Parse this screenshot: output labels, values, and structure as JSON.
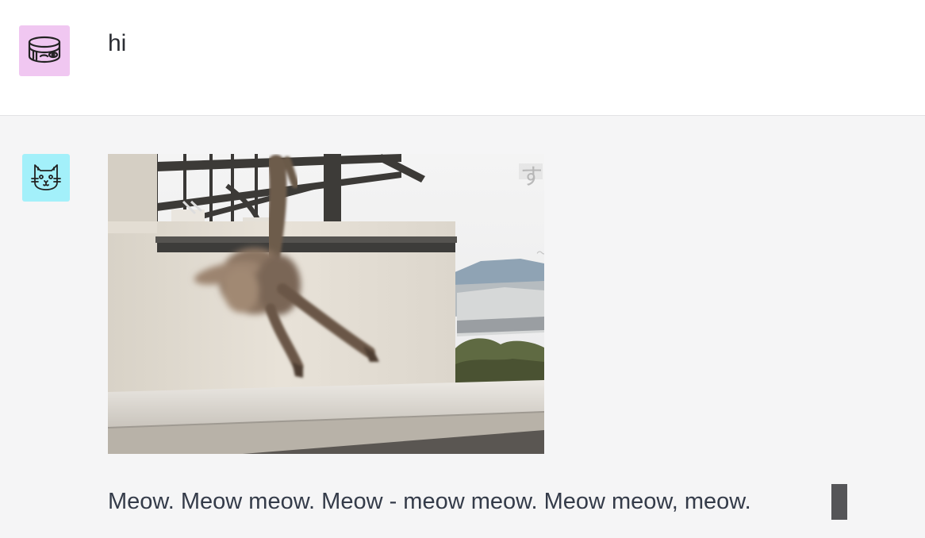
{
  "conversation": {
    "user_message": {
      "text": "hi",
      "avatar_icon": "tuna-can-icon",
      "avatar_color": "#f0c7f1"
    },
    "bot_message": {
      "avatar_icon": "cat-face-icon",
      "avatar_color": "#a3f0fa",
      "image": "cat-hanging-from-clothesline-gif",
      "text": "Meow. Meow meow. Meow - meow meow. Meow meow, meow."
    }
  },
  "colors": {
    "user_bg": "#ffffff",
    "bot_bg": "#f5f5f6",
    "divider": "#e2e2e5",
    "cursor": "#555558"
  }
}
